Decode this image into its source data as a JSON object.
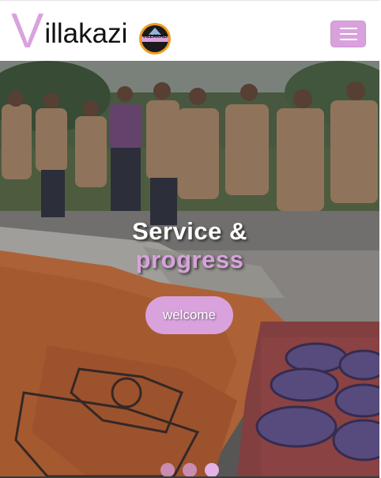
{
  "navbar": {
    "brand_first_letter": "V",
    "brand_rest": "illakazi",
    "logo_text": "VILLAKAZI",
    "toggler_icon": "hamburger-menu-icon",
    "accent_color": "#d9a2dd"
  },
  "hero": {
    "caption_line1": "Service &",
    "caption_line2": "progress",
    "button_label": "welcome",
    "slides": 3,
    "active_slide": 3
  }
}
